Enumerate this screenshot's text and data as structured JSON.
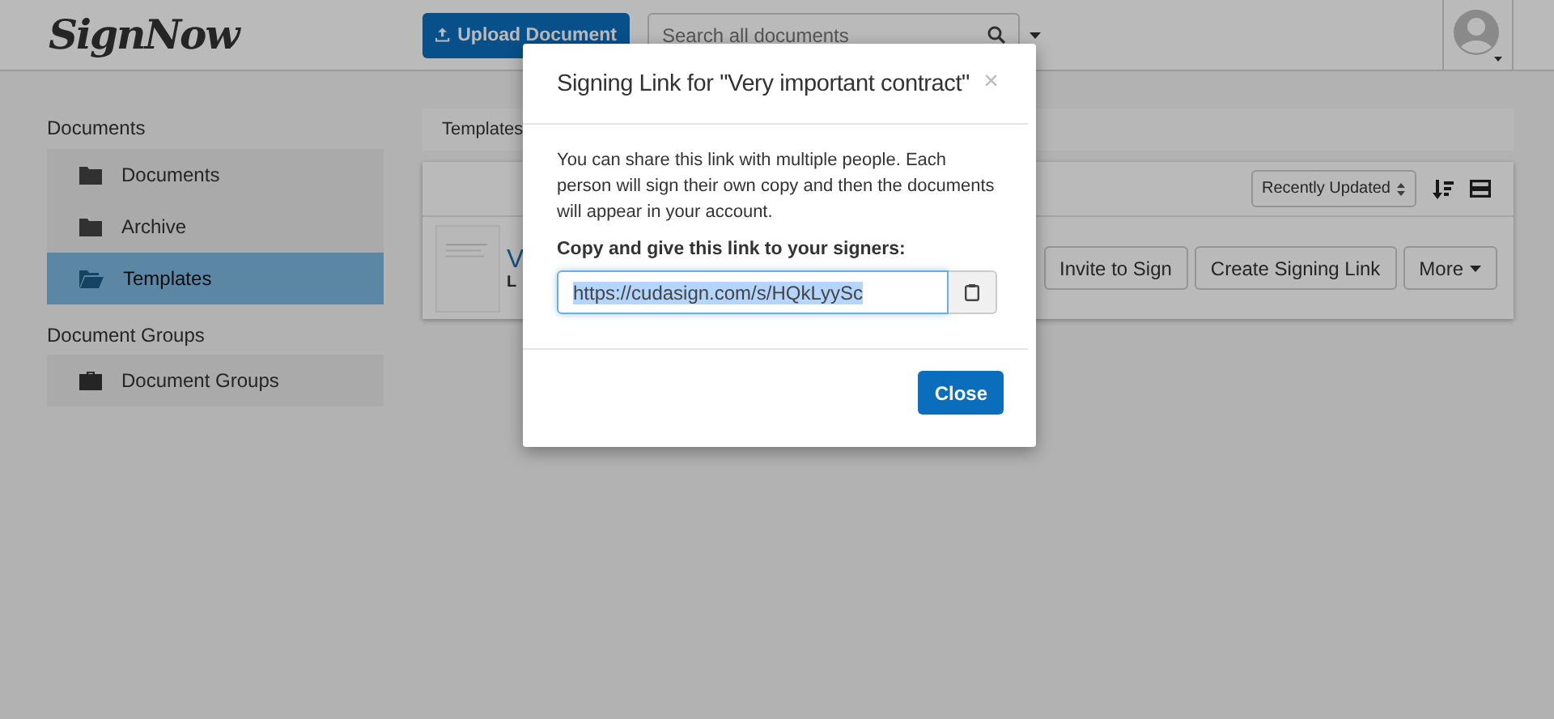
{
  "header": {
    "logo": "SignNow",
    "upload_button": "Upload Document",
    "search": {
      "placeholder": "Search all documents"
    }
  },
  "sidebar": {
    "sections": [
      {
        "heading": "Documents",
        "items": [
          {
            "label": "Documents",
            "selected": false
          },
          {
            "label": "Archive",
            "selected": false
          },
          {
            "label": "Templates",
            "selected": true
          }
        ]
      },
      {
        "heading": "Document Groups",
        "items": [
          {
            "label": "Document Groups",
            "selected": false
          }
        ]
      }
    ]
  },
  "breadcrumb": "Templates",
  "toolbar": {
    "sort": "Recently Updated"
  },
  "document": {
    "title": "V",
    "subtitle": "L",
    "actions": [
      {
        "label": "Invite to Sign",
        "kind": "plain"
      },
      {
        "label": "Create Signing Link",
        "kind": "plain"
      },
      {
        "label": "More",
        "kind": "dropdown"
      }
    ]
  },
  "dialog": {
    "title": "Signing Link for \"Very important contract\"",
    "close_symbol": "×",
    "message": "You can share this link with multiple people. Each person will sign their own copy and then the documents will appear in your account.",
    "link_label": "Copy and give this link to your signers:",
    "link": {
      "value": "https://cudasign.com/s/HQkLyySc",
      "selected": true
    },
    "close_button": "Close"
  }
}
